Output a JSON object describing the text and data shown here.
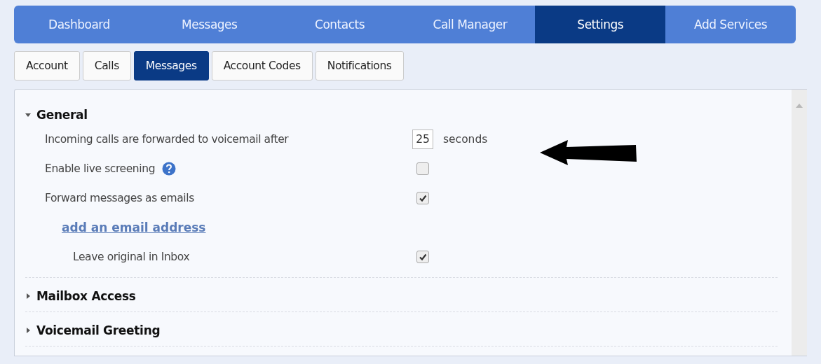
{
  "nav": [
    {
      "label": "Dashboard",
      "selected": false
    },
    {
      "label": "Messages",
      "selected": false
    },
    {
      "label": "Contacts",
      "selected": false
    },
    {
      "label": "Call Manager",
      "selected": false
    },
    {
      "label": "Settings",
      "selected": true
    },
    {
      "label": "Add Services",
      "selected": false
    }
  ],
  "subtabs": [
    {
      "label": "Account",
      "selected": false
    },
    {
      "label": "Calls",
      "selected": false
    },
    {
      "label": "Messages",
      "selected": true
    },
    {
      "label": "Account Codes",
      "selected": false
    },
    {
      "label": "Notifications",
      "selected": false
    }
  ],
  "sections": [
    {
      "title": "General",
      "expanded": true,
      "rows": [
        {
          "kind": "number",
          "label": "Incoming calls are forwarded to voicemail after",
          "value": "25",
          "unit": "seconds"
        },
        {
          "kind": "checkbox",
          "label": "Enable live screening",
          "help": true,
          "checked": false
        },
        {
          "kind": "checkbox",
          "label": "Forward messages as emails",
          "checked": true
        },
        {
          "kind": "link",
          "label": "add an email address"
        },
        {
          "kind": "checkbox",
          "label": "Leave original in Inbox",
          "checked": true,
          "indented": true
        }
      ]
    },
    {
      "title": "Mailbox Access",
      "expanded": false
    },
    {
      "title": "Voicemail Greeting",
      "expanded": false
    }
  ]
}
